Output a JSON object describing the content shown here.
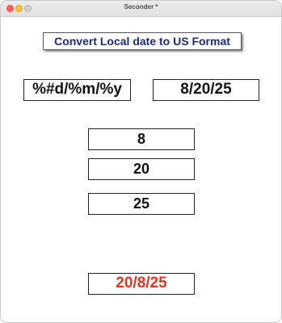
{
  "window": {
    "title": "Seconder *"
  },
  "header": {
    "label": "Convert Local date to US Format"
  },
  "format_field": {
    "value": "%#d/%m/%y"
  },
  "us_date_field": {
    "value": "8/20/25"
  },
  "parts": {
    "month": "8",
    "day": "20",
    "year": "25"
  },
  "result": {
    "value": "20/8/25",
    "color": "#e8331f"
  },
  "colors": {
    "header_text": "#1c2a84",
    "close": "#fe5f57",
    "minimize": "#febc2e",
    "maximize": "#cfcfcf"
  },
  "icons": [
    "close-icon",
    "minimize-icon",
    "maximize-icon"
  ]
}
